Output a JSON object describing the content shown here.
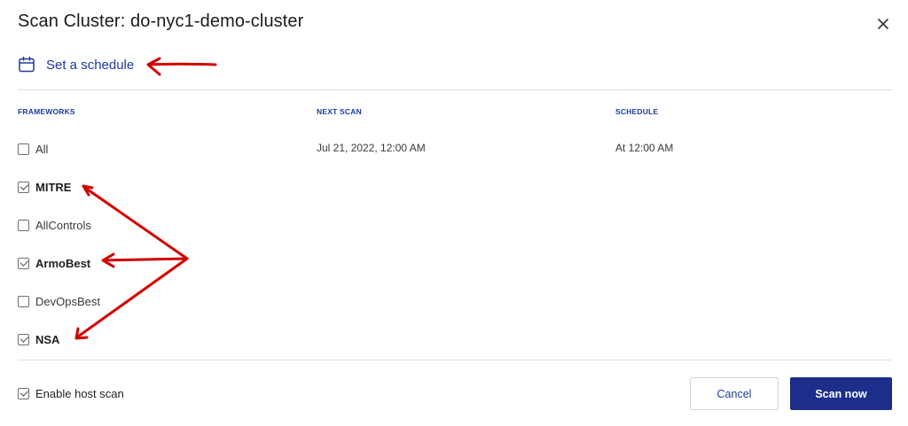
{
  "dialog": {
    "title": "Scan Cluster: do-nyc1-demo-cluster",
    "close_icon": "close-icon"
  },
  "schedule": {
    "label": "Set a schedule",
    "icon": "calendar-icon"
  },
  "table": {
    "headers": {
      "frameworks": "FRAMEWORKS",
      "next_scan": "NEXT SCAN",
      "schedule": "SCHEDULE"
    },
    "frameworks": [
      {
        "label": "All",
        "checked": false,
        "next_scan": "Jul 21, 2022, 12:00 AM",
        "schedule": "At 12:00 AM"
      },
      {
        "label": "MITRE",
        "checked": true
      },
      {
        "label": "AllControls",
        "checked": false
      },
      {
        "label": "ArmoBest",
        "checked": true
      },
      {
        "label": "DevOpsBest",
        "checked": false
      },
      {
        "label": "NSA",
        "checked": true
      }
    ]
  },
  "footer": {
    "host_scan_label": "Enable host scan",
    "host_scan_checked": true,
    "cancel_label": "Cancel",
    "scan_label": "Scan now"
  },
  "colors": {
    "accent": "#1c3a9e",
    "primary_button": "#1d2d8a",
    "annotation_arrow": "#d40000"
  }
}
